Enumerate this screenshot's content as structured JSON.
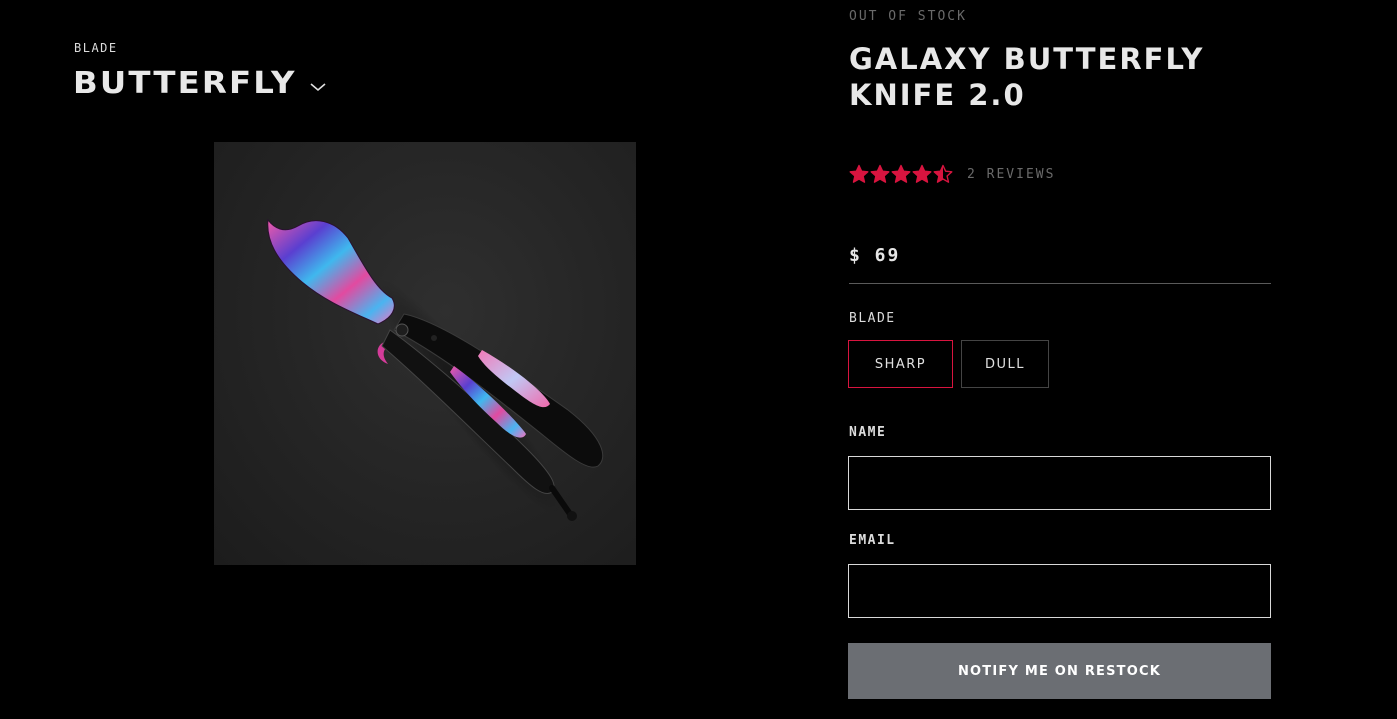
{
  "category": {
    "label": "BLADE",
    "selected": "BUTTERFLY",
    "dropdown_icon": "chevron-down-icon"
  },
  "product": {
    "image_alt": "knife-photo",
    "stock_status": "OUT OF STOCK",
    "title": "GALAXY BUTTERFLY KNIFE 2.0",
    "rating": 4.5,
    "rating_max": 5,
    "star_color": "#d8143f",
    "reviews_label": "2 REVIEWS",
    "price": "$ 69"
  },
  "options": {
    "label": "BLADE",
    "choices": [
      "SHARP",
      "DULL"
    ],
    "selected_color": "#d8143f"
  },
  "form": {
    "name_label": "NAME",
    "name_value": "",
    "email_label": "EMAIL",
    "email_value": "",
    "submit_label": "NOTIFY ME ON RESTOCK"
  }
}
